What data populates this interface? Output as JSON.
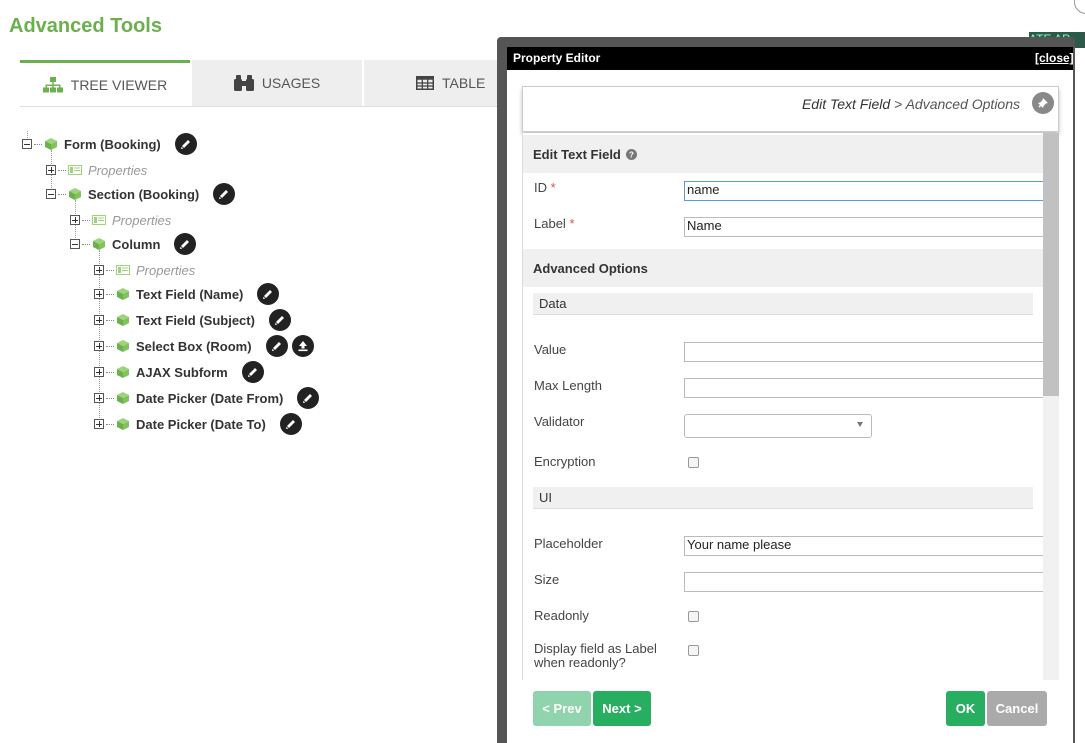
{
  "page": {
    "title": "Advanced Tools"
  },
  "tabs": [
    {
      "label": "TREE VIEWER",
      "icon": "sitemap-icon"
    },
    {
      "label": "USAGES",
      "icon": "binoculars-icon"
    },
    {
      "label": "TABLE",
      "icon": "table-icon"
    }
  ],
  "background_text": "ATE AP",
  "tree": {
    "nodes": [
      {
        "label": "Form (Booking)"
      },
      {
        "label": "Properties"
      },
      {
        "label": "Section (Booking)"
      },
      {
        "label": "Properties"
      },
      {
        "label": "Column"
      },
      {
        "label": "Properties"
      },
      {
        "label": "Text Field (Name)"
      },
      {
        "label": "Text Field (Subject)"
      },
      {
        "label": "Select Box (Room)"
      },
      {
        "label": "AJAX Subform"
      },
      {
        "label": "Date Picker (Date From)"
      },
      {
        "label": "Date Picker (Date To)"
      }
    ]
  },
  "editor": {
    "title": "Property Editor",
    "close_label": "[close]",
    "breadcrumb": {
      "current": "Edit Text Field",
      "separator": " > ",
      "next": "Advanced Options"
    },
    "section1": {
      "title": "Edit Text Field"
    },
    "fields": {
      "id": {
        "label": "ID",
        "required": "*",
        "value": "name"
      },
      "label": {
        "label": "Label",
        "required": "*",
        "value": "Name"
      }
    },
    "section2": {
      "title": "Advanced Options"
    },
    "data_group": {
      "title": "Data",
      "value_label": "Value",
      "maxlength_label": "Max Length",
      "validator_label": "Validator",
      "encryption_label": "Encryption"
    },
    "ui_group": {
      "title": "UI",
      "placeholder_label": "Placeholder",
      "placeholder_value": "Your name please",
      "size_label": "Size",
      "readonly_label": "Readonly",
      "display_label_line1": "Display field as Label",
      "display_label_line2": "when readonly?"
    },
    "buttons": {
      "prev": "< Prev",
      "next": "Next >",
      "ok": "OK",
      "cancel": "Cancel"
    }
  },
  "colors": {
    "accent": "#6ab04c",
    "button_green": "#27ae60",
    "button_disabled": "#8fd4ac",
    "cancel_gray": "#aaaaaa"
  }
}
